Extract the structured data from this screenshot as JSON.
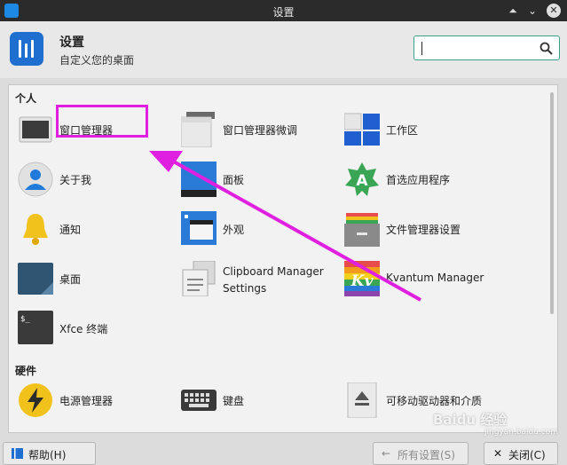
{
  "window": {
    "title": "设置",
    "shade_glyph": "⏶",
    "minimize_glyph": "⌄",
    "close_glyph": "✕"
  },
  "header": {
    "title": "设置",
    "subtitle": "自定义您的桌面"
  },
  "search": {
    "value": "",
    "placeholder": ""
  },
  "categories": {
    "personal": "个人",
    "hardware": "硬件"
  },
  "items": {
    "window_manager": "窗口管理器",
    "wm_tweaks": "窗口管理器微调",
    "workspaces": "工作区",
    "about_me": "关于我",
    "panel": "面板",
    "preferred_apps": "首选应用程序",
    "notifications": "通知",
    "appearance": "外观",
    "file_manager_settings": "文件管理器设置",
    "desktop": "桌面",
    "clipboard_line1": "Clipboard Manager",
    "clipboard_line2": "Settings",
    "kvantum": "Kvantum Manager",
    "xfce_terminal": "Xfce 终端",
    "power_manager": "电源管理器",
    "keyboard": "键盘",
    "removable_drives": "可移动驱动器和介质"
  },
  "icon_text": {
    "preferred_apps_letter": "A",
    "kvantum_letters": "Kv",
    "terminal_prompt": "$_"
  },
  "footer": {
    "help": "帮助(H)",
    "all_settings": "所有设置(S)",
    "close": "关闭(C)"
  },
  "watermark": {
    "main": "Baidu 经验",
    "sub": "jingyan.baidu.com"
  },
  "colors": {
    "accent": "#e020e0",
    "search_border": "#3aa08a",
    "titlebar": "#2b2b2b"
  }
}
